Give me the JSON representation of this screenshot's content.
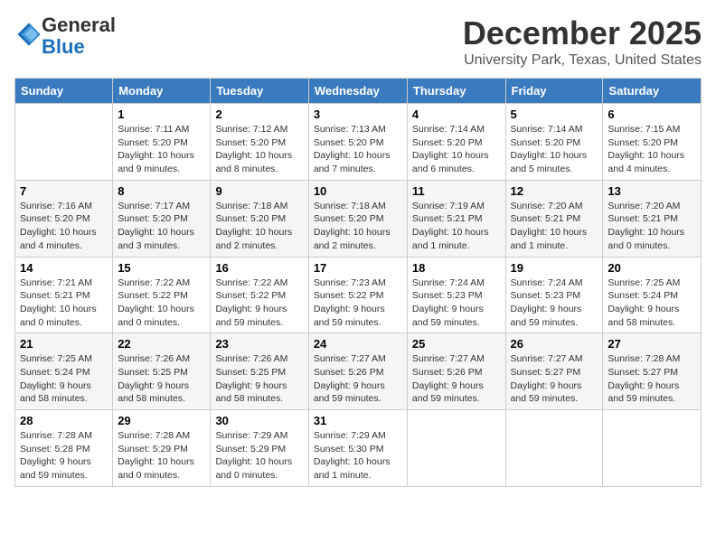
{
  "header": {
    "logo_general": "General",
    "logo_blue": "Blue",
    "month": "December 2025",
    "location": "University Park, Texas, United States"
  },
  "days_of_week": [
    "Sunday",
    "Monday",
    "Tuesday",
    "Wednesday",
    "Thursday",
    "Friday",
    "Saturday"
  ],
  "weeks": [
    [
      {
        "day": "",
        "sunrise": "",
        "sunset": "",
        "daylight": ""
      },
      {
        "day": "1",
        "sunrise": "Sunrise: 7:11 AM",
        "sunset": "Sunset: 5:20 PM",
        "daylight": "Daylight: 10 hours and 9 minutes."
      },
      {
        "day": "2",
        "sunrise": "Sunrise: 7:12 AM",
        "sunset": "Sunset: 5:20 PM",
        "daylight": "Daylight: 10 hours and 8 minutes."
      },
      {
        "day": "3",
        "sunrise": "Sunrise: 7:13 AM",
        "sunset": "Sunset: 5:20 PM",
        "daylight": "Daylight: 10 hours and 7 minutes."
      },
      {
        "day": "4",
        "sunrise": "Sunrise: 7:14 AM",
        "sunset": "Sunset: 5:20 PM",
        "daylight": "Daylight: 10 hours and 6 minutes."
      },
      {
        "day": "5",
        "sunrise": "Sunrise: 7:14 AM",
        "sunset": "Sunset: 5:20 PM",
        "daylight": "Daylight: 10 hours and 5 minutes."
      },
      {
        "day": "6",
        "sunrise": "Sunrise: 7:15 AM",
        "sunset": "Sunset: 5:20 PM",
        "daylight": "Daylight: 10 hours and 4 minutes."
      }
    ],
    [
      {
        "day": "7",
        "sunrise": "Sunrise: 7:16 AM",
        "sunset": "Sunset: 5:20 PM",
        "daylight": "Daylight: 10 hours and 4 minutes."
      },
      {
        "day": "8",
        "sunrise": "Sunrise: 7:17 AM",
        "sunset": "Sunset: 5:20 PM",
        "daylight": "Daylight: 10 hours and 3 minutes."
      },
      {
        "day": "9",
        "sunrise": "Sunrise: 7:18 AM",
        "sunset": "Sunset: 5:20 PM",
        "daylight": "Daylight: 10 hours and 2 minutes."
      },
      {
        "day": "10",
        "sunrise": "Sunrise: 7:18 AM",
        "sunset": "Sunset: 5:20 PM",
        "daylight": "Daylight: 10 hours and 2 minutes."
      },
      {
        "day": "11",
        "sunrise": "Sunrise: 7:19 AM",
        "sunset": "Sunset: 5:21 PM",
        "daylight": "Daylight: 10 hours and 1 minute."
      },
      {
        "day": "12",
        "sunrise": "Sunrise: 7:20 AM",
        "sunset": "Sunset: 5:21 PM",
        "daylight": "Daylight: 10 hours and 1 minute."
      },
      {
        "day": "13",
        "sunrise": "Sunrise: 7:20 AM",
        "sunset": "Sunset: 5:21 PM",
        "daylight": "Daylight: 10 hours and 0 minutes."
      }
    ],
    [
      {
        "day": "14",
        "sunrise": "Sunrise: 7:21 AM",
        "sunset": "Sunset: 5:21 PM",
        "daylight": "Daylight: 10 hours and 0 minutes."
      },
      {
        "day": "15",
        "sunrise": "Sunrise: 7:22 AM",
        "sunset": "Sunset: 5:22 PM",
        "daylight": "Daylight: 10 hours and 0 minutes."
      },
      {
        "day": "16",
        "sunrise": "Sunrise: 7:22 AM",
        "sunset": "Sunset: 5:22 PM",
        "daylight": "Daylight: 9 hours and 59 minutes."
      },
      {
        "day": "17",
        "sunrise": "Sunrise: 7:23 AM",
        "sunset": "Sunset: 5:22 PM",
        "daylight": "Daylight: 9 hours and 59 minutes."
      },
      {
        "day": "18",
        "sunrise": "Sunrise: 7:24 AM",
        "sunset": "Sunset: 5:23 PM",
        "daylight": "Daylight: 9 hours and 59 minutes."
      },
      {
        "day": "19",
        "sunrise": "Sunrise: 7:24 AM",
        "sunset": "Sunset: 5:23 PM",
        "daylight": "Daylight: 9 hours and 59 minutes."
      },
      {
        "day": "20",
        "sunrise": "Sunrise: 7:25 AM",
        "sunset": "Sunset: 5:24 PM",
        "daylight": "Daylight: 9 hours and 58 minutes."
      }
    ],
    [
      {
        "day": "21",
        "sunrise": "Sunrise: 7:25 AM",
        "sunset": "Sunset: 5:24 PM",
        "daylight": "Daylight: 9 hours and 58 minutes."
      },
      {
        "day": "22",
        "sunrise": "Sunrise: 7:26 AM",
        "sunset": "Sunset: 5:25 PM",
        "daylight": "Daylight: 9 hours and 58 minutes."
      },
      {
        "day": "23",
        "sunrise": "Sunrise: 7:26 AM",
        "sunset": "Sunset: 5:25 PM",
        "daylight": "Daylight: 9 hours and 58 minutes."
      },
      {
        "day": "24",
        "sunrise": "Sunrise: 7:27 AM",
        "sunset": "Sunset: 5:26 PM",
        "daylight": "Daylight: 9 hours and 59 minutes."
      },
      {
        "day": "25",
        "sunrise": "Sunrise: 7:27 AM",
        "sunset": "Sunset: 5:26 PM",
        "daylight": "Daylight: 9 hours and 59 minutes."
      },
      {
        "day": "26",
        "sunrise": "Sunrise: 7:27 AM",
        "sunset": "Sunset: 5:27 PM",
        "daylight": "Daylight: 9 hours and 59 minutes."
      },
      {
        "day": "27",
        "sunrise": "Sunrise: 7:28 AM",
        "sunset": "Sunset: 5:27 PM",
        "daylight": "Daylight: 9 hours and 59 minutes."
      }
    ],
    [
      {
        "day": "28",
        "sunrise": "Sunrise: 7:28 AM",
        "sunset": "Sunset: 5:28 PM",
        "daylight": "Daylight: 9 hours and 59 minutes."
      },
      {
        "day": "29",
        "sunrise": "Sunrise: 7:28 AM",
        "sunset": "Sunset: 5:29 PM",
        "daylight": "Daylight: 10 hours and 0 minutes."
      },
      {
        "day": "30",
        "sunrise": "Sunrise: 7:29 AM",
        "sunset": "Sunset: 5:29 PM",
        "daylight": "Daylight: 10 hours and 0 minutes."
      },
      {
        "day": "31",
        "sunrise": "Sunrise: 7:29 AM",
        "sunset": "Sunset: 5:30 PM",
        "daylight": "Daylight: 10 hours and 1 minute."
      },
      {
        "day": "",
        "sunrise": "",
        "sunset": "",
        "daylight": ""
      },
      {
        "day": "",
        "sunrise": "",
        "sunset": "",
        "daylight": ""
      },
      {
        "day": "",
        "sunrise": "",
        "sunset": "",
        "daylight": ""
      }
    ]
  ]
}
